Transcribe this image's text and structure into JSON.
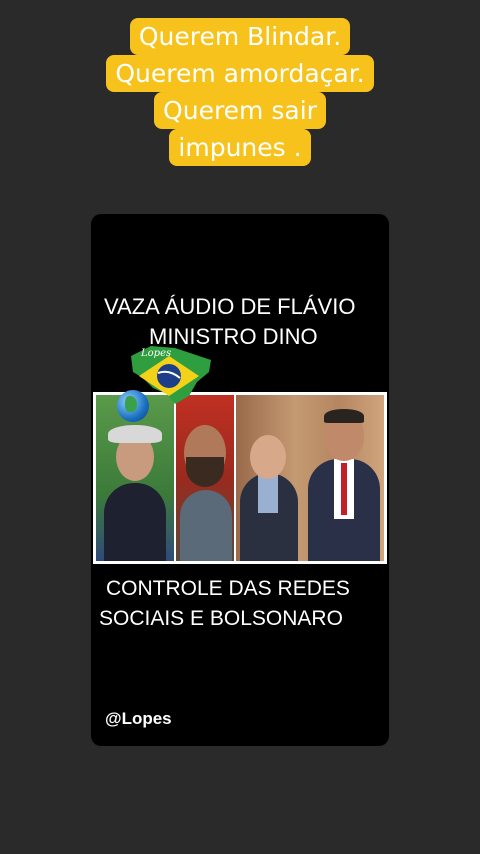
{
  "caption": {
    "lines": [
      "Querem Blindar.",
      "Querem amordaçar.",
      "Querem sair",
      "impunes ."
    ],
    "background_color": "#f7c21b",
    "text_color": "#ffffff"
  },
  "video": {
    "headline_line1": "VAZA  ÁUDIO DE FLÁVIO",
    "headline_line2": "MINISTRO DINO",
    "map_badge_text": "Lopes",
    "map_badge_icon": "brazil-flag-map-icon",
    "globe_icon": "globe-icon",
    "subheadline_line1": "CONTROLE DAS REDES",
    "subheadline_line2": "SOCIAIS E BOLSONARO",
    "handle": "@Lopes"
  }
}
